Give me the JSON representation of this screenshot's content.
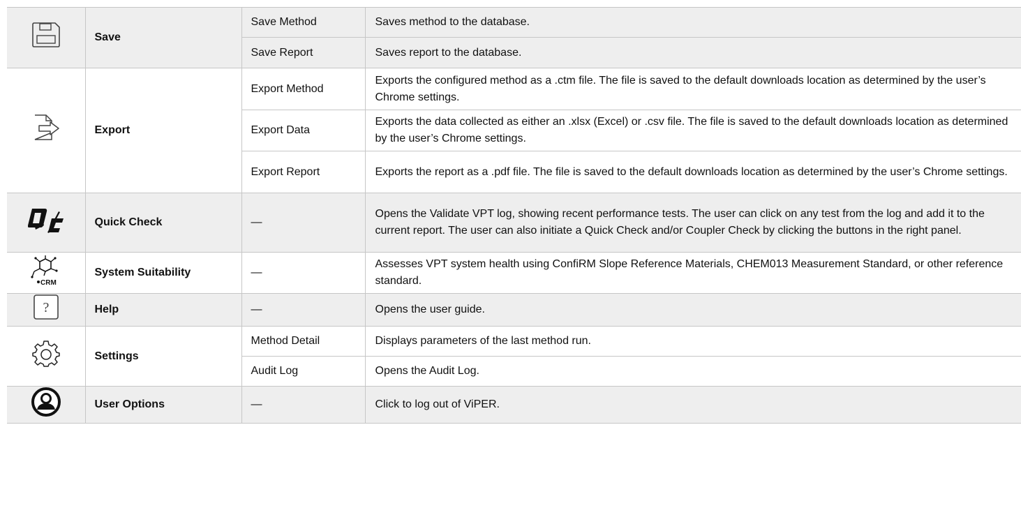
{
  "rows": [
    {
      "icon": "floppy-disk-icon",
      "name": "Save",
      "subs": [
        {
          "label": "Save Method",
          "desc": "Saves method to the database."
        },
        {
          "label": "Save Report",
          "desc": "Saves report to the database."
        }
      ]
    },
    {
      "icon": "export-arrow-icon",
      "name": "Export",
      "subs": [
        {
          "label": "Export Method",
          "desc": "Exports the configured method as a .ctm file. The file is saved to the default downloads location as determined by the user’s Chrome settings."
        },
        {
          "label": "Export Data",
          "desc": "Exports the data collected as either an .xlsx (Excel) or .csv file. The file is saved to the default downloads location as determined by the user’s Chrome settings."
        },
        {
          "label": "Export Report",
          "desc": "Exports the report as a .pdf file. The file is saved to the default downloads location as determined by the user’s Chrome settings."
        }
      ]
    },
    {
      "icon": "qc-logo-icon",
      "icon_text": "QC",
      "name": "Quick Check",
      "subs": [
        {
          "label": "—",
          "desc": "Opens the Validate VPT log, showing recent performance tests. The user can click on any test from the log and add it to the current report. The user can also initiate a Quick Check and/or Coupler Check by clicking the buttons in the right panel."
        }
      ]
    },
    {
      "icon": "crm-molecule-icon",
      "icon_text": "CRM",
      "name": "System Suitability",
      "subs": [
        {
          "label": "—",
          "desc": "Assesses VPT system health using ConfiRM Slope Reference Materials, CHEM013 Measurement Standard, or other reference standard."
        }
      ]
    },
    {
      "icon": "help-question-icon",
      "icon_text": "?",
      "name": "Help",
      "subs": [
        {
          "label": "—",
          "desc": "Opens the user guide."
        }
      ]
    },
    {
      "icon": "gear-icon",
      "name": "Settings",
      "subs": [
        {
          "label": "Method Detail",
          "desc": "Displays parameters of the last method run."
        },
        {
          "label": "Audit Log",
          "desc": "Opens the Audit Log."
        }
      ]
    },
    {
      "icon": "user-profile-icon",
      "name": "User Options",
      "subs": [
        {
          "label": "—",
          "desc": "Click to log out of ViPER."
        }
      ]
    }
  ],
  "colors": {
    "shade": "#eeeeee",
    "border": "#c6c6c6",
    "text": "#111111"
  }
}
